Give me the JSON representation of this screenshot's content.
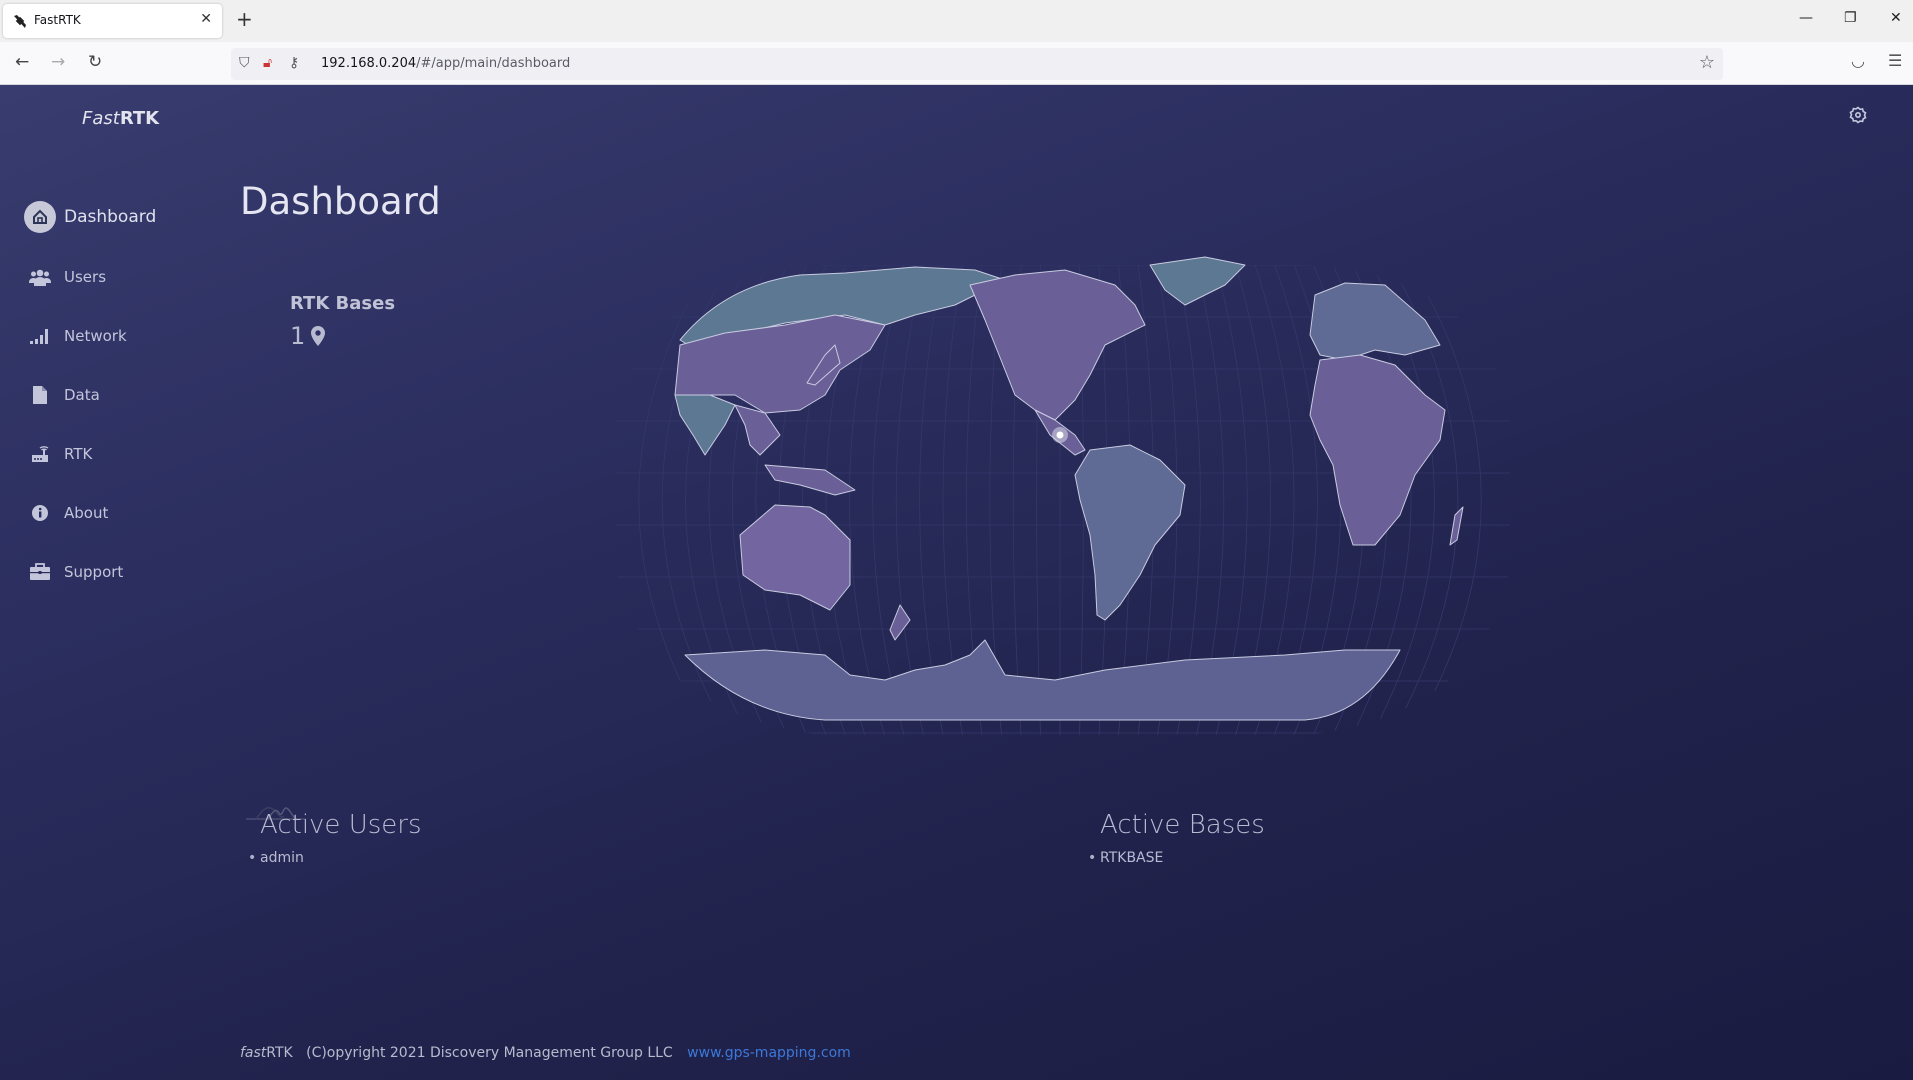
{
  "browser": {
    "tab_title": "FastRTK",
    "url_host": "192.168.0.204",
    "url_path": "/#/app/main/dashboard"
  },
  "app": {
    "logo_italic": "Fast",
    "logo_bold": "RTK",
    "page_title": "Dashboard",
    "sidebar": {
      "items": [
        {
          "label": "Dashboard",
          "icon": "home-icon",
          "active": true
        },
        {
          "label": "Users",
          "icon": "users-icon",
          "active": false
        },
        {
          "label": "Network",
          "icon": "signal-icon",
          "active": false
        },
        {
          "label": "Data",
          "icon": "file-icon",
          "active": false
        },
        {
          "label": "RTK",
          "icon": "router-icon",
          "active": false
        },
        {
          "label": "About",
          "icon": "info-icon",
          "active": false
        },
        {
          "label": "Support",
          "icon": "briefcase-icon",
          "active": false
        }
      ]
    },
    "rtk_bases": {
      "title": "RTK Bases",
      "count": "1"
    },
    "map": {
      "markers": [
        {
          "name": "base-location",
          "lon": -123.0,
          "lat": 45.5
        }
      ]
    },
    "active_users": {
      "title": "Active Users",
      "items": [
        "admin"
      ]
    },
    "active_bases": {
      "title": "Active Bases",
      "items": [
        "RTKBASE"
      ]
    },
    "footer": {
      "brand_italic": "fast",
      "brand_rest": "RTK",
      "copyright": "(C)opyright 2021 Discovery Management Group LLC",
      "link": "www.gps-mapping.com"
    },
    "colors": {
      "bg_top": "#383c6e",
      "bg_bottom": "#1a1b40",
      "land_purple": "#6b5f98",
      "land_teal": "#5d7893",
      "border": "#c8cbe0",
      "link": "#3c78d8"
    }
  }
}
